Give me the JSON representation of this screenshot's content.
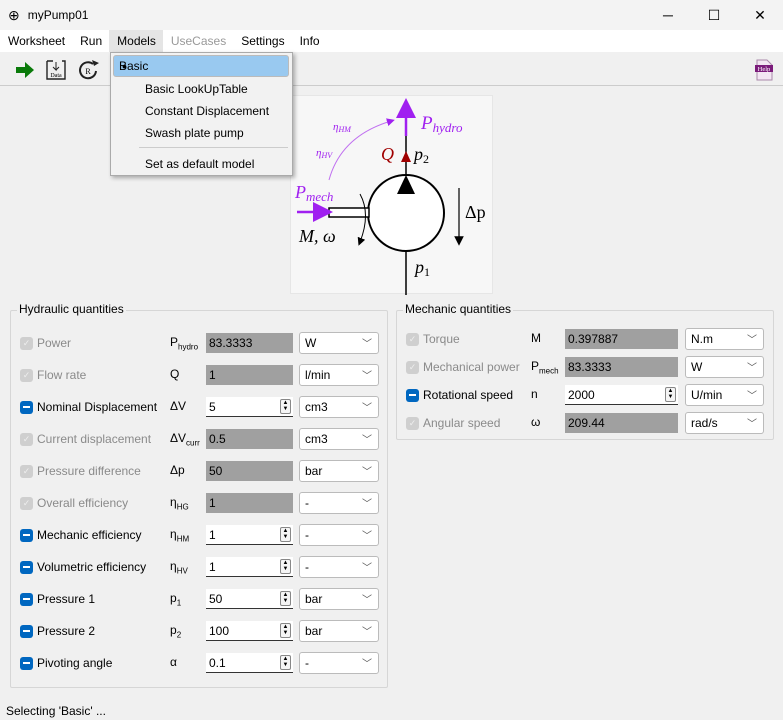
{
  "window": {
    "title": "myPump01",
    "minimize": "─",
    "maximize": "☐",
    "close": "✕"
  },
  "menu": [
    "Worksheet",
    "Run",
    "Models",
    "UseCases",
    "Settings",
    "Info"
  ],
  "models_menu": {
    "items": [
      "Basic",
      "Basic LookUpTable",
      "Constant Displacement",
      "Swash plate pump"
    ],
    "selected_marker": "•",
    "default_item": "Set as default model"
  },
  "toolbar": {
    "help_label": "Help",
    "data_label": "Data",
    "reset_label": "R"
  },
  "diagram": {
    "p_hydro": "P",
    "p_hydro_sub": "hydro",
    "p_mech": "P",
    "p_mech_sub": "mech",
    "eta_hm": "η",
    "eta_hm_sub": "HM",
    "eta_hv": "η",
    "eta_hv_sub": "HV",
    "q": "Q",
    "p2": "p",
    "p2_sub": "2",
    "p1": "p",
    "p1_sub": "1",
    "dp": "Δp",
    "m_omega": "M, ω"
  },
  "hydraulic": {
    "title": "Hydraulic quantities",
    "rows": [
      {
        "label": "Power",
        "sym": "P",
        "sub": "hydro",
        "value": "83.3333",
        "unit": "W",
        "editable": false
      },
      {
        "label": "Flow rate",
        "sym": "Q",
        "sub": "",
        "value": "1",
        "unit": "l/min",
        "editable": false
      },
      {
        "label": "Nominal Displacement",
        "sym": "ΔV",
        "sub": "",
        "value": "5",
        "unit": "cm3",
        "editable": true
      },
      {
        "label": "Current displacement",
        "sym": "ΔV",
        "sub": "curr",
        "value": "0.5",
        "unit": "cm3",
        "editable": false
      },
      {
        "label": "Pressure difference",
        "sym": "Δp",
        "sub": "",
        "value": "50",
        "unit": "bar",
        "editable": false
      },
      {
        "label": "Overall efficiency",
        "sym": "η",
        "sub": "HG",
        "value": "1",
        "unit": "-",
        "editable": false
      },
      {
        "label": "Mechanic efficiency",
        "sym": "η",
        "sub": "HM",
        "value": "1",
        "unit": "-",
        "editable": true
      },
      {
        "label": "Volumetric efficiency",
        "sym": "η",
        "sub": "HV",
        "value": "1",
        "unit": "-",
        "editable": true
      },
      {
        "label": "Pressure 1",
        "sym": "p",
        "sub": "1",
        "value": "50",
        "unit": "bar",
        "editable": true
      },
      {
        "label": "Pressure 2",
        "sym": "p",
        "sub": "2",
        "value": "100",
        "unit": "bar",
        "editable": true
      },
      {
        "label": "Pivoting angle",
        "sym": "α",
        "sub": "",
        "value": "0.1",
        "unit": "-",
        "editable": true
      }
    ]
  },
  "mechanic": {
    "title": "Mechanic quantities",
    "rows": [
      {
        "label": "Torque",
        "sym": "M",
        "sub": "",
        "value": "0.397887",
        "unit": "N.m",
        "editable": false
      },
      {
        "label": "Mechanical power",
        "sym": "P",
        "sub": "mech",
        "value": "83.3333",
        "unit": "W",
        "editable": false
      },
      {
        "label": "Rotational speed",
        "sym": "n",
        "sub": "",
        "value": "2000",
        "unit": "U/min",
        "editable": true
      },
      {
        "label": "Angular speed",
        "sym": "ω",
        "sub": "",
        "value": "209.44",
        "unit": "rad/s",
        "editable": false
      }
    ]
  },
  "status": "Selecting 'Basic' ..."
}
